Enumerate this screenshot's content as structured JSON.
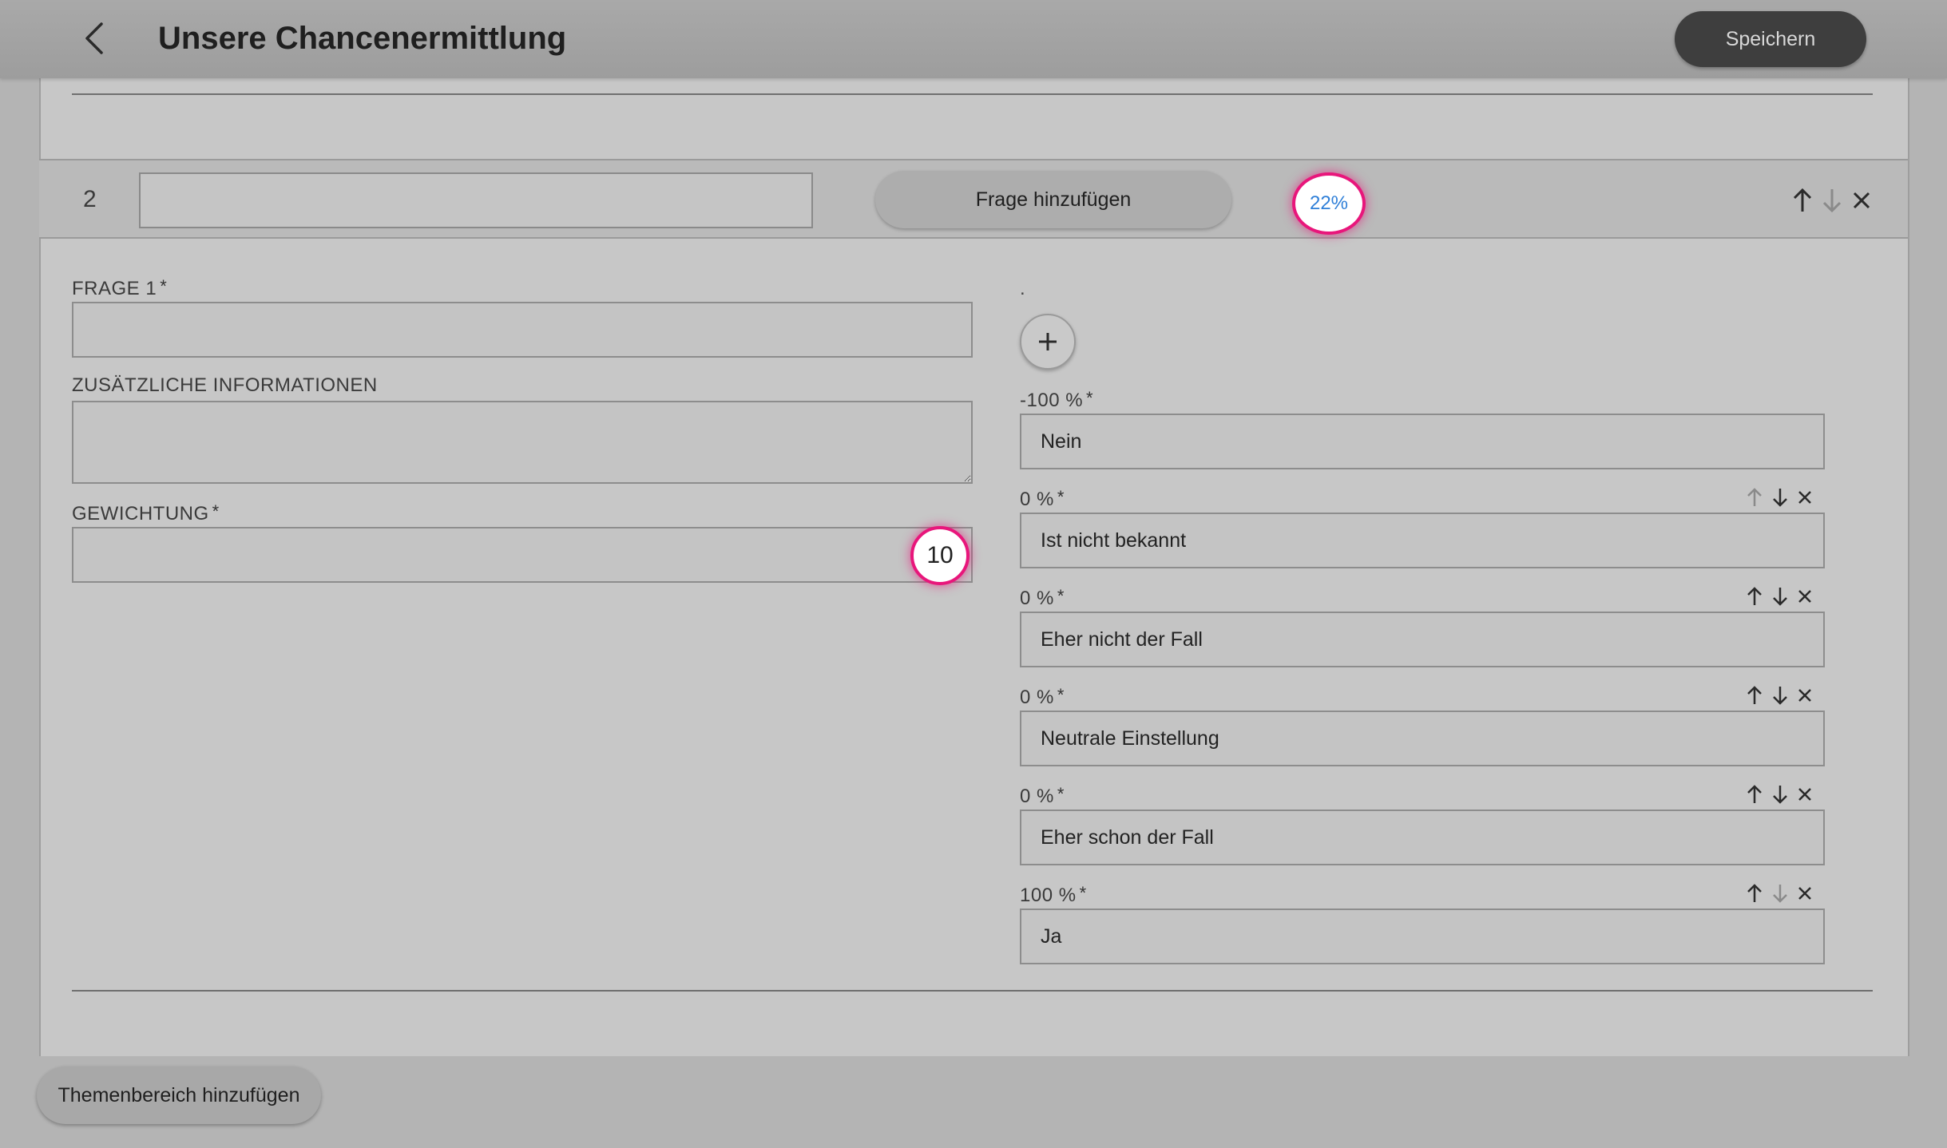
{
  "header": {
    "title": "Unsere Chancenermittlung",
    "save_label": "Speichern"
  },
  "section": {
    "number": "2",
    "name_value": "",
    "add_question_label": "Frage hinzufügen",
    "percent": "22%",
    "icons": [
      "arrow-up-icon",
      "arrow-down-icon",
      "close-icon"
    ]
  },
  "question": {
    "label": "FRAGE 1",
    "required_marker": "*",
    "value": "",
    "info_label": "ZUSÄTZLICHE INFORMATIONEN",
    "info_value": "",
    "weight_label": "GEWICHTUNG",
    "weight_value": "10"
  },
  "answers": {
    "dot": ".",
    "add_icon": "plus-icon",
    "items": [
      {
        "percent_label": "-100 %",
        "text": "Nein"
      },
      {
        "percent_label": "0 %",
        "text": "Ist nicht bekannt"
      },
      {
        "percent_label": "0 %",
        "text": "Eher nicht der Fall"
      },
      {
        "percent_label": "0 %",
        "text": "Neutrale Einstellung"
      },
      {
        "percent_label": "0 %",
        "text": "Eher schon der Fall"
      },
      {
        "percent_label": "100 %",
        "text": "Ja"
      }
    ]
  },
  "footer": {
    "add_topic_label": "Themenbereich hinzufügen"
  },
  "colors": {
    "accent_ring": "#e8167b",
    "percent_text": "#2f7fd8",
    "save_button": "#3e3e3e"
  }
}
